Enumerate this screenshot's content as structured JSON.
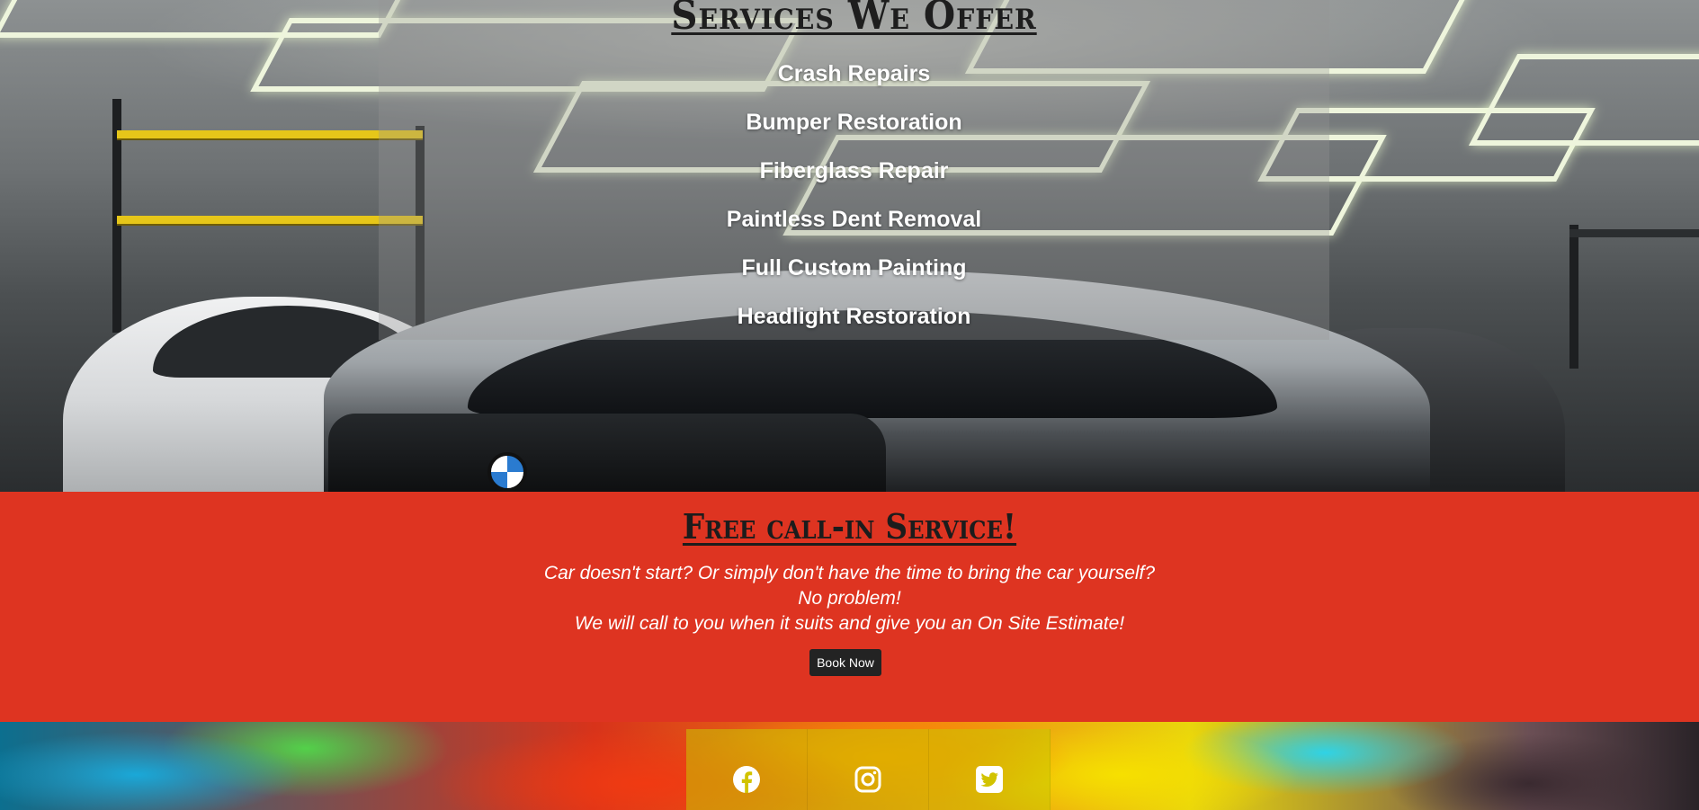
{
  "services": {
    "title": "Services We Offer",
    "items": [
      {
        "label": "Crash Repairs"
      },
      {
        "label": "Bumper Restoration"
      },
      {
        "label": "Fiberglass Repair"
      },
      {
        "label": "Paintless Dent Removal"
      },
      {
        "label": "Full Custom Painting"
      },
      {
        "label": "Headlight Restoration"
      }
    ]
  },
  "callin": {
    "title": "Free call-in Service!",
    "lines": [
      "Car doesn't start? Or simply don't have the time to bring the car yourself?",
      "No problem!",
      "We will call to you when it suits and give you an On Site Estimate!"
    ],
    "button_label": "Book Now",
    "background_color": "#de3421"
  },
  "footer": {
    "social_icons": [
      "facebook-icon",
      "instagram-icon",
      "twitter-icon"
    ]
  }
}
